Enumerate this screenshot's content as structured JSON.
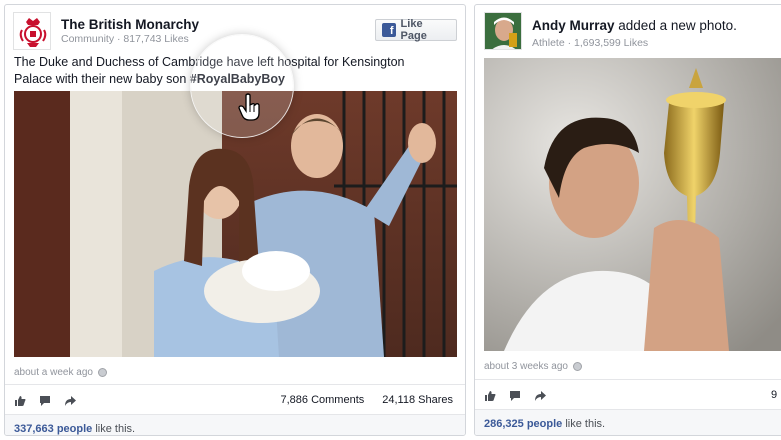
{
  "posts": [
    {
      "page_name": "The British Monarchy",
      "meta": "Community · 817,743 Likes",
      "like_button": "Like Page",
      "text_prefix": "The Duke and Duchess of Cambridge have left hospital for Kensington Palace with their new baby son ",
      "hashtag": "#RoyalBabyBoy",
      "timestamp": "about a week ago",
      "comments": "7,886 Comments",
      "shares": "24,118 Shares",
      "likes_count": "337,663 people",
      "likes_suffix": " like this."
    },
    {
      "page_name": "Andy Murray",
      "action": " added a new photo.",
      "meta": "Athlete · 1,693,599 Likes",
      "timestamp": "about 3 weeks ago",
      "stats_partial": "9",
      "likes_count": "286,325 people",
      "likes_suffix": " like this."
    }
  ],
  "icons": [
    "royal-crest-icon",
    "facebook-icon",
    "globe-icon",
    "like-icon",
    "comment-icon",
    "share-icon",
    "hand-cursor-icon"
  ],
  "colors": {
    "link": "#3b5998",
    "facebook_blue": "#3b5998",
    "meta_gray": "#90949c"
  }
}
